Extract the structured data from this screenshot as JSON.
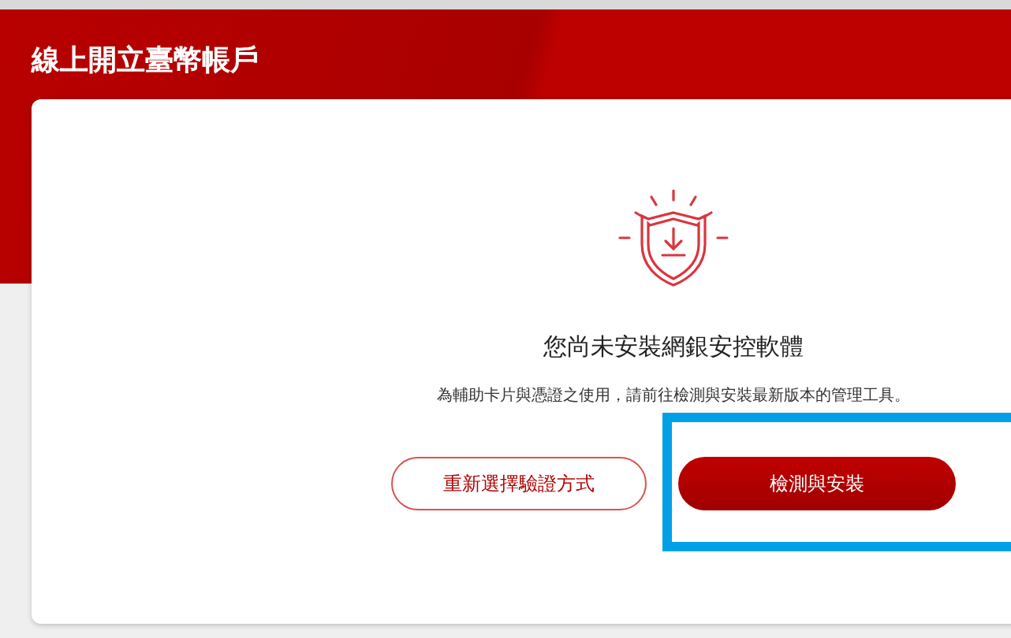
{
  "header": {
    "title": "線上開立臺幣帳戶"
  },
  "notice": {
    "heading": "您尚未安裝網銀安控軟體",
    "message": "為輔助卡片與憑證之使用，請前往檢測與安裝最新版本的管理工具。"
  },
  "buttons": [
    {
      "label": "重新選擇驗證方式",
      "kind": "outline"
    },
    {
      "label": "檢測與安裝",
      "kind": "primary",
      "highlighted": true
    }
  ]
}
